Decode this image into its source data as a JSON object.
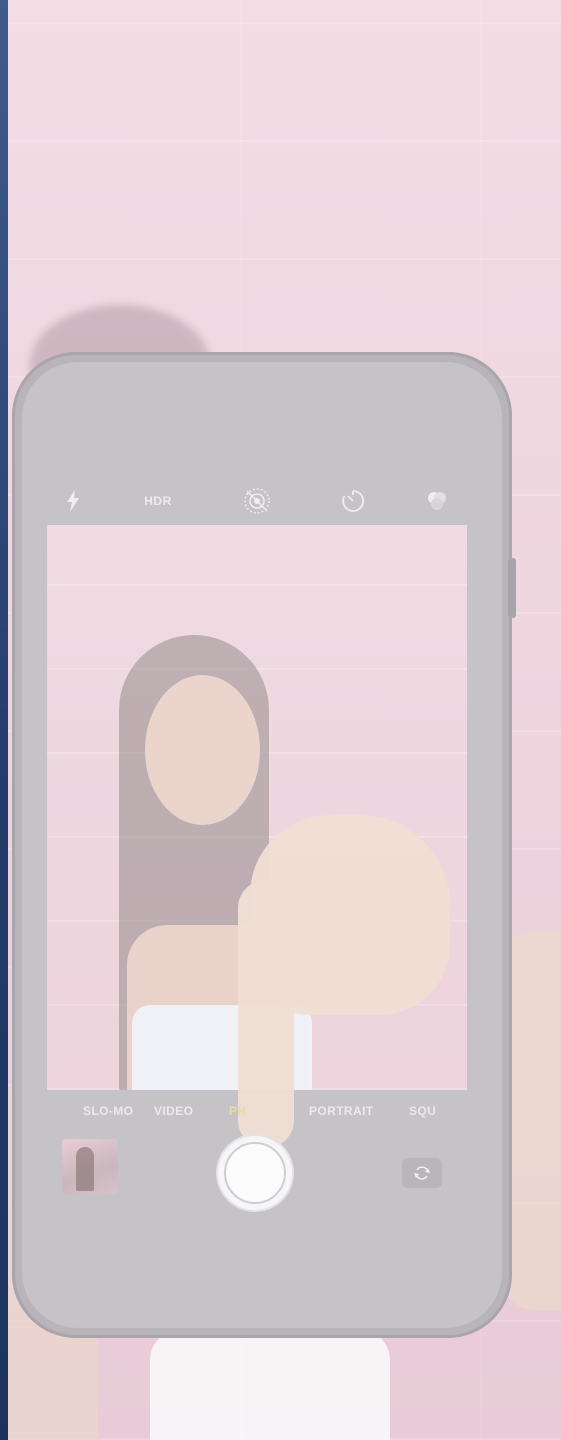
{
  "camera": {
    "top_controls": {
      "flash_icon": "lightning-bolt",
      "hdr_label": "HDR",
      "live_photo_icon": "concentric-circles-crossed",
      "timer_icon": "timer",
      "filters_icon": "overlapping-circles"
    },
    "modes": [
      "SLO-MO",
      "VIDEO",
      "PH",
      "PORTRAIT",
      "SQU"
    ],
    "active_mode_index": 2,
    "bottom_controls": {
      "shutter_icon": "shutter-circle",
      "flip_icon": "camera-flip",
      "thumbnail_icon": "last-photo-thumbnail"
    }
  },
  "colors": {
    "background": "#eed5de",
    "phone_frame": "#b8b4b9",
    "active_mode": "#e8dca5",
    "left_edge": "#243c6b"
  }
}
